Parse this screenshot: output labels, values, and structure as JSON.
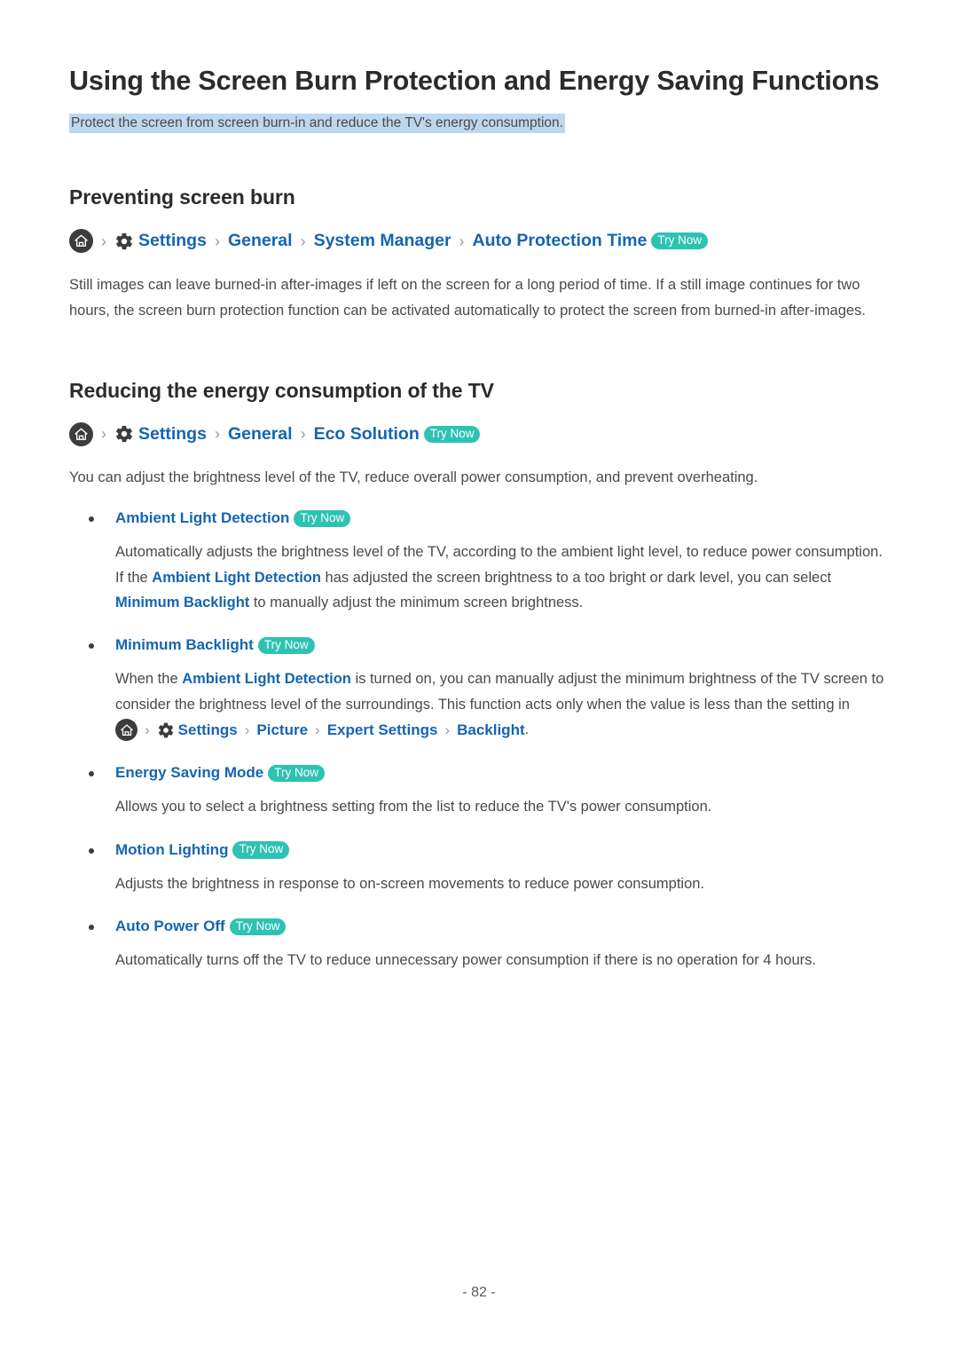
{
  "page": {
    "title": "Using the Screen Burn Protection and Energy Saving Functions",
    "subtitle": "Protect the screen from screen burn-in and reduce the TV's energy consumption.",
    "footer": "- 82 -"
  },
  "colors": {
    "link_blue": "#1565b0",
    "badge_teal": "#2ec2b3",
    "highlight_blue": "#bdd7ee",
    "text_gray": "#4a4a4a",
    "heading_dark": "#2b2b2b"
  },
  "icons": {
    "home": "home-icon",
    "gear": "gear-icon",
    "separator": "›"
  },
  "badges": {
    "try_now": "Try Now"
  },
  "sections": [
    {
      "heading": "Preventing screen burn",
      "breadcrumb": [
        "Settings",
        "General",
        "System Manager",
        "Auto Protection Time"
      ],
      "paragraph": "Still images can leave burned-in after-images if left on the screen for a long period of time. If a still image continues for two hours, the screen burn protection function can be activated automatically to protect the screen from burned-in after-images."
    },
    {
      "heading": "Reducing the energy consumption of the TV",
      "breadcrumb": [
        "Settings",
        "General",
        "Eco Solution"
      ],
      "paragraph": "You can adjust the brightness level of the TV, reduce overall power consumption, and prevent overheating."
    }
  ],
  "bullets": [
    {
      "title": "Ambient Light Detection",
      "body_1": "Automatically adjusts the brightness level of the TV, according to the ambient light level, to reduce power consumption. If the ",
      "link_1": "Ambient Light Detection",
      "body_2": " has adjusted the screen brightness to a too bright or dark level, you can select ",
      "link_2": "Minimum Backlight",
      "body_3": " to manually adjust the minimum screen brightness."
    },
    {
      "title": "Minimum Backlight",
      "body_1": "When the ",
      "link_1": "Ambient Light Detection",
      "body_2": " is turned on, you can manually adjust the minimum brightness of the TV screen to consider the brightness level of the surroundings. This function acts only when the value is less than the setting in ",
      "inline_breadcrumb": [
        "Settings",
        "Picture",
        "Expert Settings",
        "Backlight"
      ],
      "body_3": "."
    },
    {
      "title": "Energy Saving Mode",
      "body_1": "Allows you to select a brightness setting from the list to reduce the TV's power consumption."
    },
    {
      "title": "Motion Lighting",
      "body_1": "Adjusts the brightness in response to on-screen movements to reduce power consumption."
    },
    {
      "title": "Auto Power Off",
      "body_1": "Automatically turns off the TV to reduce unnecessary power consumption if there is no operation for 4 hours."
    }
  ]
}
